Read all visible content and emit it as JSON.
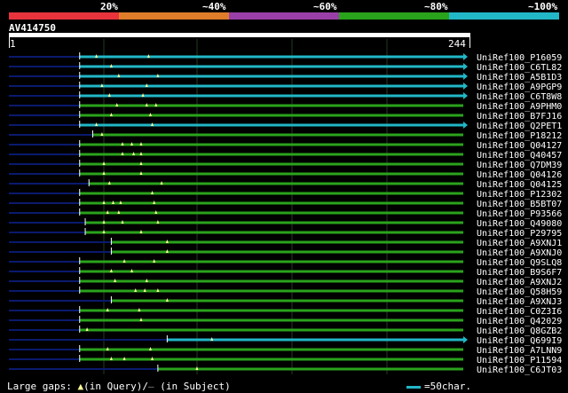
{
  "legend": {
    "labels": [
      "20%",
      "~40%",
      "~60%",
      "~80%",
      "~100%"
    ],
    "colors": [
      "#e8333d",
      "#e07d2a",
      "#9b3fa8",
      "#2aa31c",
      "#21b7c7"
    ]
  },
  "query": {
    "id": "AV414750",
    "start": "1",
    "end": "244",
    "length": 244
  },
  "colors": {
    "high": "#21b7c7",
    "mid": "#2aa31c",
    "query_line": "#0a1a6e",
    "grid": "#1f3d1f",
    "gap": "#ffff99"
  },
  "hits": [
    {
      "name": "UniRef100_P16059",
      "s": 38,
      "e": 244,
      "cls": "high",
      "gaps": [
        47,
        75
      ]
    },
    {
      "name": "UniRef100_C6TL82",
      "s": 38,
      "e": 244,
      "cls": "high",
      "gaps": [
        55
      ]
    },
    {
      "name": "UniRef100_A5B1D3",
      "s": 38,
      "e": 244,
      "cls": "high",
      "gaps": [
        59,
        80
      ]
    },
    {
      "name": "UniRef100_A9PGP9",
      "s": 38,
      "e": 244,
      "cls": "high",
      "gaps": [
        50,
        74
      ]
    },
    {
      "name": "UniRef100_C6T8W8",
      "s": 38,
      "e": 244,
      "cls": "high",
      "gaps": [
        54,
        72
      ]
    },
    {
      "name": "UniRef100_A9PHM0",
      "s": 38,
      "e": 244,
      "cls": "mid",
      "gaps": [
        58,
        74,
        79
      ]
    },
    {
      "name": "UniRef100_B7FJ16",
      "s": 38,
      "e": 244,
      "cls": "mid",
      "gaps": [
        55,
        76
      ]
    },
    {
      "name": "UniRef100_Q2PET1",
      "s": 38,
      "e": 244,
      "cls": "high",
      "gaps": [
        47,
        77
      ]
    },
    {
      "name": "UniRef100_P18212",
      "s": 45,
      "e": 244,
      "cls": "mid",
      "gaps": [
        50
      ]
    },
    {
      "name": "UniRef100_Q04127",
      "s": 38,
      "e": 244,
      "cls": "mid",
      "gaps": [
        61,
        66,
        71
      ]
    },
    {
      "name": "UniRef100_Q40457",
      "s": 38,
      "e": 244,
      "cls": "mid",
      "gaps": [
        61,
        67,
        71
      ]
    },
    {
      "name": "UniRef100_Q7DM39",
      "s": 38,
      "e": 244,
      "cls": "mid",
      "gaps": [
        51,
        71
      ]
    },
    {
      "name": "UniRef100_Q04126",
      "s": 38,
      "e": 244,
      "cls": "mid",
      "gaps": [
        51,
        71
      ]
    },
    {
      "name": "UniRef100_Q04125",
      "s": 43,
      "e": 244,
      "cls": "mid",
      "gaps": [
        54,
        82
      ]
    },
    {
      "name": "UniRef100_P12302",
      "s": 38,
      "e": 244,
      "cls": "mid",
      "gaps": [
        77
      ]
    },
    {
      "name": "UniRef100_B5BT07",
      "s": 38,
      "e": 244,
      "cls": "mid",
      "gaps": [
        51,
        56,
        60,
        78
      ]
    },
    {
      "name": "UniRef100_P93566",
      "s": 38,
      "e": 244,
      "cls": "mid",
      "gaps": [
        53,
        59,
        79
      ]
    },
    {
      "name": "UniRef100_Q49080",
      "s": 41,
      "e": 244,
      "cls": "mid",
      "gaps": [
        51,
        61,
        80
      ]
    },
    {
      "name": "UniRef100_P29795",
      "s": 41,
      "e": 244,
      "cls": "mid",
      "gaps": [
        51,
        71
      ]
    },
    {
      "name": "UniRef100_A9XNJ1",
      "s": 55,
      "e": 244,
      "cls": "mid",
      "gaps": [
        85
      ]
    },
    {
      "name": "UniRef100_A9XNJ0",
      "s": 55,
      "e": 244,
      "cls": "mid",
      "gaps": [
        85
      ]
    },
    {
      "name": "UniRef100_Q9SLQ8",
      "s": 38,
      "e": 244,
      "cls": "mid",
      "gaps": [
        62,
        78
      ]
    },
    {
      "name": "UniRef100_B9S6F7",
      "s": 38,
      "e": 244,
      "cls": "mid",
      "gaps": [
        55,
        66
      ]
    },
    {
      "name": "UniRef100_A9XNJ2",
      "s": 38,
      "e": 244,
      "cls": "mid",
      "gaps": [
        57,
        74
      ]
    },
    {
      "name": "UniRef100_Q58H59",
      "s": 38,
      "e": 244,
      "cls": "mid",
      "gaps": [
        68,
        73,
        80
      ]
    },
    {
      "name": "UniRef100_A9XNJ3",
      "s": 55,
      "e": 244,
      "cls": "mid",
      "gaps": [
        85
      ]
    },
    {
      "name": "UniRef100_C0Z3I6",
      "s": 38,
      "e": 244,
      "cls": "mid",
      "gaps": [
        53,
        70
      ]
    },
    {
      "name": "UniRef100_Q42029",
      "s": 38,
      "e": 244,
      "cls": "mid",
      "gaps": [
        71
      ]
    },
    {
      "name": "UniRef100_Q8GZB2",
      "s": 38,
      "e": 244,
      "cls": "mid",
      "gaps": [
        42
      ]
    },
    {
      "name": "UniRef100_Q699I9",
      "s": 85,
      "e": 244,
      "cls": "high",
      "gaps": [
        109
      ]
    },
    {
      "name": "UniRef100_A7LNN9",
      "s": 38,
      "e": 244,
      "cls": "mid",
      "gaps": [
        53,
        76
      ]
    },
    {
      "name": "UniRef100_P11594",
      "s": 38,
      "e": 244,
      "cls": "mid",
      "gaps": [
        55,
        62,
        77
      ]
    },
    {
      "name": "UniRef100_C6JT03",
      "s": 80,
      "e": 244,
      "cls": "mid",
      "gaps": [
        101
      ]
    }
  ],
  "footer": {
    "left_prefix": "Large gaps:",
    "left_query": "(in Query)/",
    "left_subject": "(in Subject)",
    "right": "=50char."
  }
}
